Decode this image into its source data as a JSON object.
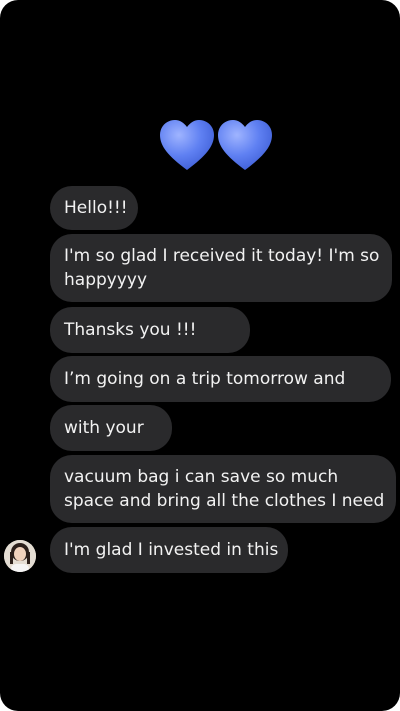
{
  "conversation": {
    "reaction_icon": "blue-hearts",
    "accent_color": "#5a7cf0",
    "messages": [
      {
        "text": "Hello!!!"
      },
      {
        "text": "I'm so glad I received it today! I'm so",
        "text2": "happyyyy"
      },
      {
        "text": "Thansks you !!!"
      },
      {
        "text": "I’m going on a trip tomorrow and"
      },
      {
        "text": "with your"
      },
      {
        "text": "vacuum bag i can save so much",
        "text2": "space and bring all the clothes I need"
      },
      {
        "text": "I'm glad I invested in this"
      }
    ]
  }
}
